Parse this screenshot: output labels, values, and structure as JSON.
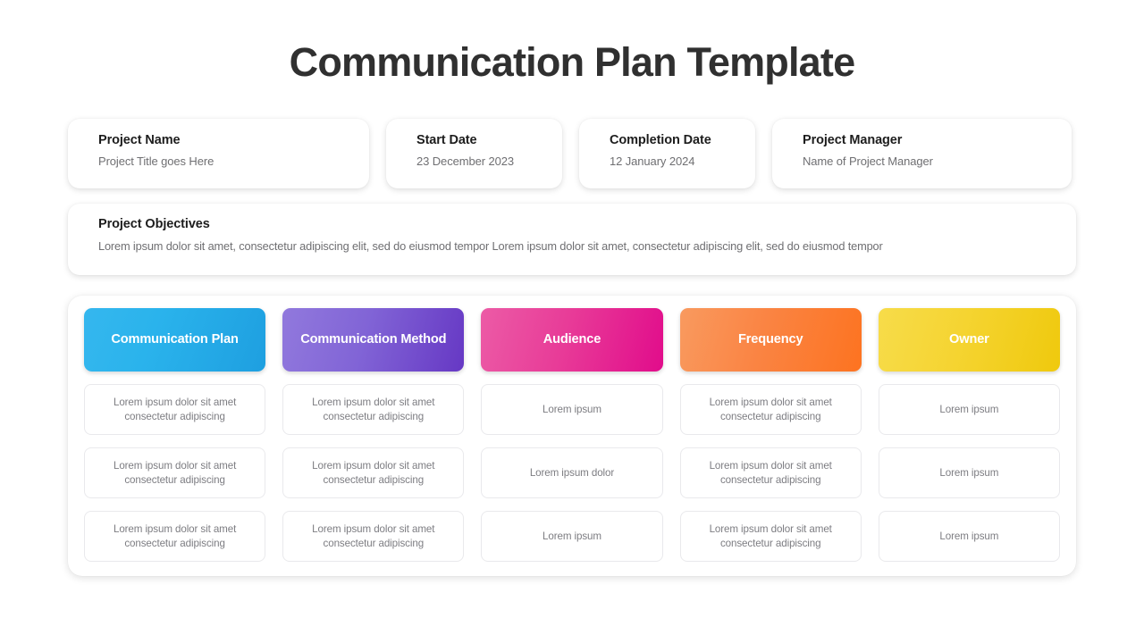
{
  "title": "Communication Plan Template",
  "info_cards": [
    {
      "label": "Project Name",
      "value": "Project Title goes Here"
    },
    {
      "label": "Start Date",
      "value": "23 December 2023"
    },
    {
      "label": "Completion Date",
      "value": "12 January 2024"
    },
    {
      "label": "Project Manager",
      "value": "Name of Project Manager"
    }
  ],
  "objectives": {
    "label": "Project Objectives",
    "text": "Lorem ipsum dolor sit amet, consectetur adipiscing elit, sed do eiusmod tempor Lorem ipsum dolor sit amet, consectetur adipiscing elit, sed do eiusmod tempor"
  },
  "table": {
    "headers": [
      {
        "label": "Communication Plan",
        "color": "#2ab3ec"
      },
      {
        "label": "Communication Method",
        "color": "#8164d6"
      },
      {
        "label": "Audience",
        "color": "#e83c98"
      },
      {
        "label": "Frequency",
        "color": "#fa8443"
      },
      {
        "label": "Owner",
        "color": "#f5d431"
      }
    ],
    "rows": [
      [
        "Lorem ipsum dolor sit amet consectetur adipiscing",
        "Lorem ipsum dolor sit amet consectetur adipiscing",
        "Lorem ipsum",
        "Lorem ipsum dolor sit amet consectetur adipiscing",
        "Lorem ipsum"
      ],
      [
        "Lorem ipsum dolor sit amet consectetur adipiscing",
        "Lorem ipsum dolor sit amet consectetur adipiscing",
        "Lorem ipsum dolor",
        "Lorem ipsum dolor sit amet consectetur adipiscing",
        "Lorem ipsum"
      ],
      [
        "Lorem ipsum dolor sit amet consectetur adipiscing",
        "Lorem ipsum dolor sit amet consectetur adipiscing",
        "Lorem ipsum",
        "Lorem ipsum dolor sit amet consectetur adipiscing",
        "Lorem ipsum"
      ]
    ]
  }
}
